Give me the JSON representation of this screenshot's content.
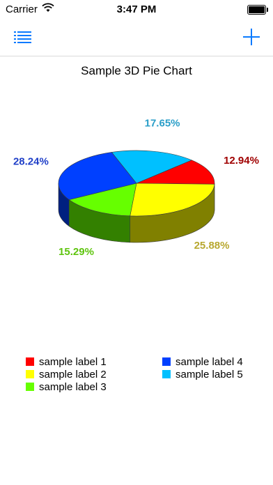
{
  "status_bar": {
    "carrier": "Carrier",
    "time": "3:47 PM"
  },
  "nav": {
    "list_icon": "list-icon",
    "add_icon": "plus-icon",
    "accent": "#0a7aff"
  },
  "chart_data": {
    "type": "pie",
    "title": "Sample 3D Pie Chart",
    "style": "3d",
    "slices": [
      {
        "label": "sample label 1",
        "value": 12.94,
        "pct_text": "12.94%",
        "color": "#ff0000",
        "side_color": "#800000",
        "label_color": "#a00000"
      },
      {
        "label": "sample label 2",
        "value": 25.88,
        "pct_text": "25.88%",
        "color": "#ffff00",
        "side_color": "#808000",
        "label_color": "#b8a830"
      },
      {
        "label": "sample label 3",
        "value": 15.29,
        "pct_text": "15.29%",
        "color": "#66ff00",
        "side_color": "#338000",
        "label_color": "#5ec40e"
      },
      {
        "label": "sample label 4",
        "value": 28.24,
        "pct_text": "28.24%",
        "color": "#0040ff",
        "side_color": "#002080",
        "label_color": "#2040c8"
      },
      {
        "label": "sample label 5",
        "value": 17.65,
        "pct_text": "17.65%",
        "color": "#00c0ff",
        "side_color": "#006080",
        "label_color": "#2a9ec8"
      }
    ],
    "legend_position": "bottom"
  }
}
